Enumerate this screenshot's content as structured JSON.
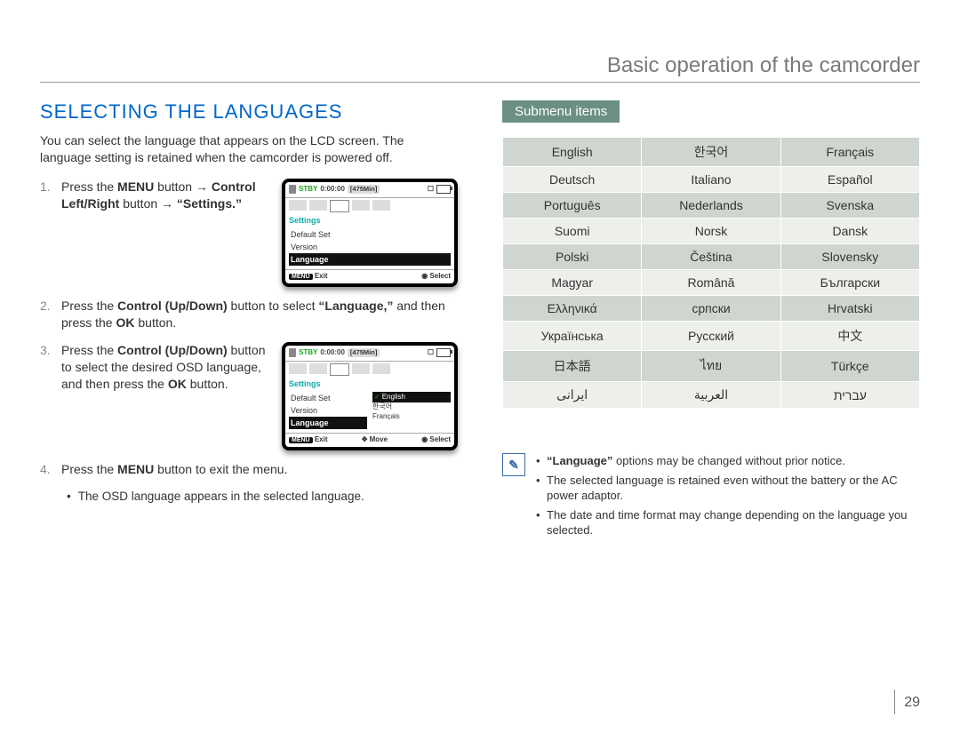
{
  "header": {
    "title": "Basic operation of the camcorder"
  },
  "left": {
    "heading": "SELECTING THE LANGUAGES",
    "intro": "You can select the language that appears on the LCD screen. The language setting is retained when the camcorder is powered off.",
    "steps": [
      {
        "num": "1.",
        "parts": [
          {
            "t": "Press the "
          },
          {
            "t": "MENU",
            "b": true
          },
          {
            "t": " button → "
          },
          {
            "t": "Control Left/Right",
            "b": true
          },
          {
            "t": " button → "
          },
          {
            "t": "“Settings.”",
            "b": true
          }
        ]
      },
      {
        "num": "2.",
        "parts": [
          {
            "t": "Press the "
          },
          {
            "t": "Control (Up/Down)",
            "b": true
          },
          {
            "t": " button to select "
          },
          {
            "t": "“Language,”",
            "b": true
          },
          {
            "t": " and then press the "
          },
          {
            "t": "OK",
            "b": true
          },
          {
            "t": " button."
          }
        ]
      },
      {
        "num": "3.",
        "parts": [
          {
            "t": "Press the "
          },
          {
            "t": "Control (Up/Down)",
            "b": true
          },
          {
            "t": " button to select the desired OSD language, and then press the "
          },
          {
            "t": "OK",
            "b": true
          },
          {
            "t": " button."
          }
        ]
      },
      {
        "num": "4.",
        "parts": [
          {
            "t": "Press the "
          },
          {
            "t": "MENU",
            "b": true
          },
          {
            "t": " button to exit the menu."
          }
        ]
      }
    ],
    "bullet": "The OSD language appears in the selected language.",
    "lcd1": {
      "stby": "STBY",
      "time": "0:00:00",
      "remain": "[475Min]",
      "cat": "Settings",
      "items": [
        "Default Set",
        "Version",
        "Language"
      ],
      "selected": 2,
      "foot": {
        "a_btn": "MENU",
        "a": "Exit",
        "b_icon": "dot",
        "b": "Select"
      }
    },
    "lcd2": {
      "stby": "STBY",
      "time": "0:00:00",
      "remain": "[475Min]",
      "cat": "Settings",
      "left_items": [
        "Default Set",
        "Version",
        "Language"
      ],
      "left_selected": 2,
      "right_items": [
        "English",
        "한국어",
        "Français"
      ],
      "right_selected": 0,
      "foot": {
        "a_btn": "MENU",
        "a": "Exit",
        "b_icon": "arrows",
        "b": "Move",
        "c_icon": "dot",
        "c": "Select"
      }
    }
  },
  "right": {
    "pill": "Submenu items",
    "languages": [
      [
        "English",
        "한국어",
        "Français"
      ],
      [
        "Deutsch",
        "Italiano",
        "Español"
      ],
      [
        "Português",
        "Nederlands",
        "Svenska"
      ],
      [
        "Suomi",
        "Norsk",
        "Dansk"
      ],
      [
        "Polski",
        "Čeština",
        "Slovensky"
      ],
      [
        "Magyar",
        "Română",
        "Български"
      ],
      [
        "Ελληνικά",
        "српски",
        "Hrvatski"
      ],
      [
        "Українська",
        "Русский",
        "中文"
      ],
      [
        "日本語",
        "ไทย",
        "Türkçe"
      ],
      [
        "ایرانی",
        "العربیة",
        "עברית"
      ]
    ],
    "notes": [
      [
        {
          "t": "“Language”",
          "b": true
        },
        {
          "t": " options may be changed without prior notice."
        }
      ],
      [
        {
          "t": "The selected language is retained even without the battery or the AC power adaptor."
        }
      ],
      [
        {
          "t": "The date and time format may change depending on the language you selected."
        }
      ]
    ]
  },
  "page_number": "29"
}
